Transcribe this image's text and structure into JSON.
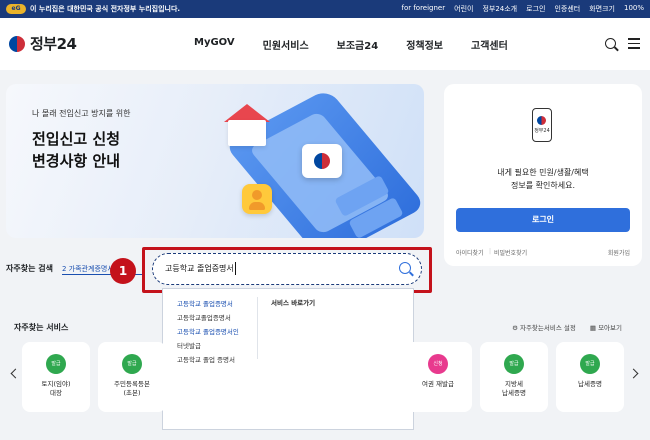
{
  "topbar": {
    "logo_text": "eG",
    "notice": "이 누리집은 대한민국 공식 전자정부 누리집입니다.",
    "links": [
      "for foreigner",
      "어린이",
      "정부24소개",
      "로그인",
      "인증센터",
      "화면크기",
      "100%"
    ]
  },
  "header": {
    "logo_text": "정부24",
    "nav": [
      "MyGOV",
      "민원서비스",
      "보조금24",
      "정책정보",
      "고객센터"
    ]
  },
  "banner": {
    "subtitle": "나 몰래 전입신고 방지를 위한",
    "title_line1": "전입신고 신청",
    "title_line2": "변경사항 안내"
  },
  "login": {
    "app_label": "정부24",
    "message_line1": "내게 필요한 민원/생활/혜택",
    "message_line2": "정보를 확인하세요.",
    "button": "로그인",
    "find_id": "아이디찾기",
    "find_pw": "비밀번호찾기",
    "signup": "회원가입"
  },
  "search": {
    "frequent_label": "자주찾는 검색",
    "frequent_tag": "2 가족관계증명서",
    "value": "고등학교 졸업증명서",
    "step": "1"
  },
  "dropdown": {
    "items": [
      {
        "text": "고등학교 졸업증명서",
        "highlight": true
      },
      {
        "text": "고등학교졸업증명서",
        "highlight": false
      },
      {
        "text": "고등학교 졸업증명서인",
        "highlight": true
      },
      {
        "text": "터넷발급",
        "highlight": false
      },
      {
        "text": "고등학교 졸업 증명서",
        "highlight": false
      }
    ],
    "right_header": "서비스 바로가기"
  },
  "services": {
    "title": "자주찾는 서비스",
    "setting": "자주찾는서비스 설정",
    "view_all": "모아보기",
    "cards": [
      {
        "badge": "발급",
        "color": "#2fa84f",
        "line1": "토지(임야)",
        "line2": "대장"
      },
      {
        "badge": "발급",
        "color": "#2fa84f",
        "line1": "주민등록등본",
        "line2": "(초본)"
      },
      {
        "badge": "신청",
        "color": "#e83a8e",
        "line1": "여권 재발급",
        "line2": ""
      },
      {
        "badge": "발급",
        "color": "#2fa84f",
        "line1": "지방세",
        "line2": "납세증명"
      },
      {
        "badge": "발급",
        "color": "#2fa84f",
        "line1": "납세증명",
        "line2": ""
      }
    ]
  }
}
